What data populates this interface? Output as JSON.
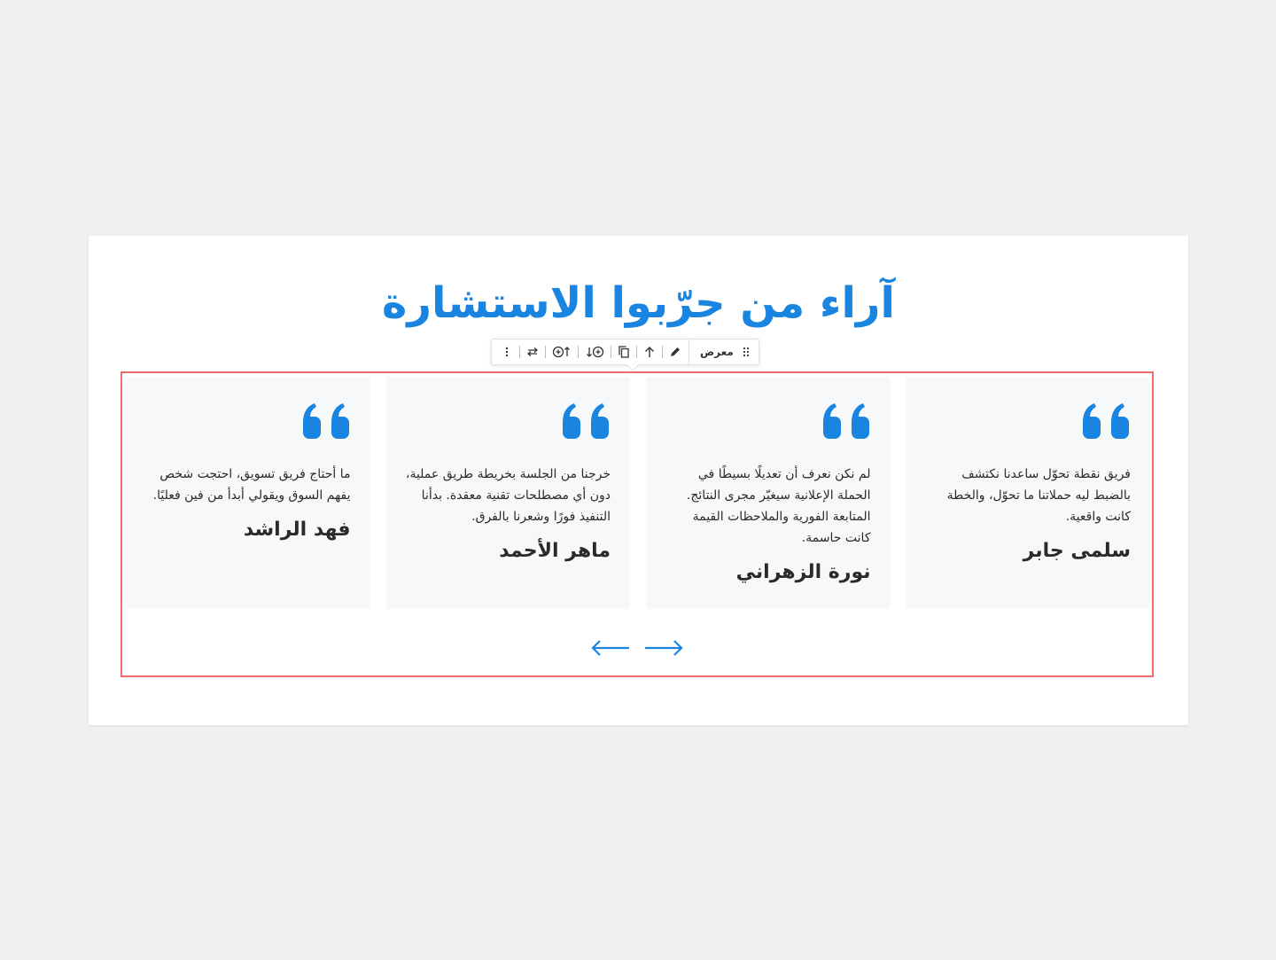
{
  "section": {
    "title": "آراء من جرّبوا الاستشارة"
  },
  "toolbar": {
    "block_label": "معرض",
    "icons": [
      "drag-handle-icon",
      "pencil-icon",
      "arrow-up-icon",
      "copy-icon",
      "add-after-icon",
      "add-before-icon",
      "swap-icon",
      "more-vertical-icon"
    ]
  },
  "testimonials": [
    {
      "text": "فريق نقطة تحوّل ساعدنا نكتشف بالضبط ليه حملاتنا ما تحوّل، والخطة كانت واقعية.",
      "author": "سلمى جابر"
    },
    {
      "text": "لم نكن نعرف أن تعديلًا بسيطًا في الحملة الإعلانية سيغيّر مجرى النتائج. المتابعة الفورية والملاحظات القيمة كانت حاسمة.",
      "author": "نورة الزهراني"
    },
    {
      "text": "خرجنا من الجلسة بخريطة طريق عملية، دون أي مصطلحات تقنية معقدة. بدأنا التنفيذ فورًا وشعرنا بالفرق.",
      "author": "ماهر الأحمد"
    },
    {
      "text": "ما أحتاج فريق تسويق، احتجت شخص يفهم السوق ويقولي أبدأ من فين فعليًا.",
      "author": "فهد الراشد"
    }
  ],
  "colors": {
    "accent": "#1a85e0",
    "selection_outline": "#f26b6b",
    "card_bg": "#f7f8fa",
    "text": "#2a2a2a"
  }
}
